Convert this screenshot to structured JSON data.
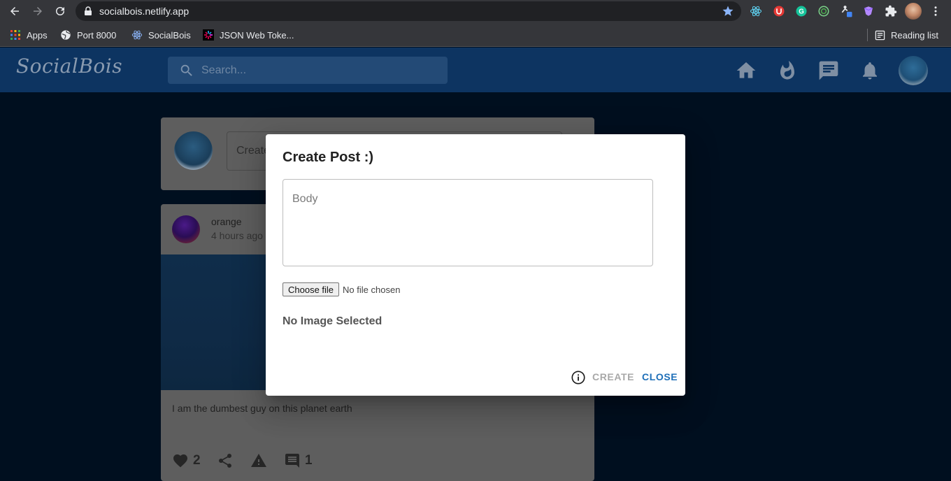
{
  "browser": {
    "url": "socialbois.netlify.app",
    "reading_list_label": "Reading list",
    "bookmarks": [
      {
        "label": "Apps",
        "icon": "apps-grid-icon"
      },
      {
        "label": "Port 8000",
        "icon": "globe-icon"
      },
      {
        "label": "SocialBois",
        "icon": "react-icon"
      },
      {
        "label": "JSON Web Toke...",
        "icon": "jwt-icon"
      }
    ],
    "extensions": [
      "react-devtools-icon",
      "ublock-icon",
      "grammarly-icon",
      "extension-target-icon",
      "extension-figure-icon",
      "extension-gem-icon",
      "puzzle-icon",
      "profile-avatar-icon",
      "menu-kebab-icon"
    ]
  },
  "app": {
    "logo": "SocialBois",
    "search_placeholder": "Search...",
    "nav_icons": [
      "home-icon",
      "fire-icon",
      "chat-icon",
      "bell-icon",
      "profile-avatar"
    ],
    "accent_color": "#0d3461"
  },
  "feed": {
    "create_placeholder": "Create",
    "post": {
      "username": "orange",
      "time": "4 hours ago",
      "body": "I am the dumbest guy on this planet earth",
      "likes": "2",
      "comments": "1"
    }
  },
  "dialog": {
    "title": "Create Post :)",
    "body_placeholder": "Body",
    "file_button": "Choose file",
    "file_status": "No file chosen",
    "image_status": "No Image Selected",
    "create_label": "CREATE",
    "close_label": "CLOSE",
    "close_color": "#1e6fb8"
  }
}
